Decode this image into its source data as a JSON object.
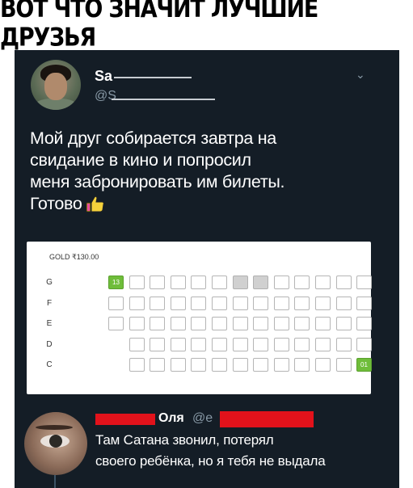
{
  "meme": {
    "title": "ВОТ ЧТО ЗНАЧИТ ЛУЧШИЕ ДРУЗЬЯ"
  },
  "tweet": {
    "user_name": "Sa",
    "user_handle": "@S",
    "chevron": "⌄",
    "text_lines": [
      "Мой друг собирается завтра на",
      "свидание в кино и попросил",
      "меня забронировать им билеты.",
      "Готово"
    ],
    "emoji": "thumbs-up-icon"
  },
  "seat_map": {
    "header": "GOLD ₹130.00",
    "rows": [
      {
        "label": "G",
        "seats": [
          "13",
          "e",
          "e",
          "e",
          "e",
          "e",
          "g",
          "g",
          "e",
          "e",
          "e",
          "e",
          "e"
        ]
      },
      {
        "label": "F",
        "seats": [
          "e",
          "e",
          "e",
          "e",
          "e",
          "e",
          "e",
          "e",
          "e",
          "e",
          "e",
          "e",
          "e"
        ]
      },
      {
        "label": "E",
        "seats": [
          "e",
          "e",
          "e",
          "e",
          "e",
          "e",
          "e",
          "e",
          "e",
          "e",
          "e",
          "e",
          "e"
        ]
      },
      {
        "label": "D",
        "seats": [
          "",
          "e",
          "e",
          "e",
          "e",
          "e",
          "e",
          "e",
          "e",
          "e",
          "e",
          "e",
          "e"
        ]
      },
      {
        "label": "C",
        "seats": [
          "",
          "e",
          "e",
          "e",
          "e",
          "e",
          "e",
          "e",
          "e",
          "e",
          "e",
          "e",
          "01"
        ]
      }
    ]
  },
  "reply": {
    "name": "Оля",
    "handle": "@e",
    "text_lines": [
      "Там Сатана звонил, потерял",
      "своего ребёнка, но я тебя не  выдала"
    ]
  },
  "colors": {
    "background": "#141d26",
    "seat_selected": "#6fbd3a",
    "seat_blocked": "#d0d0d0",
    "redaction": "#e2121b"
  }
}
